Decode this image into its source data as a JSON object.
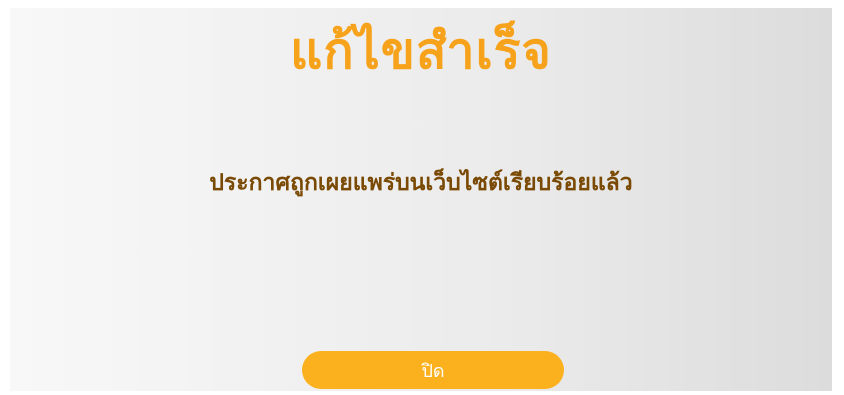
{
  "dialog": {
    "title": "แก้ไขสำเร็จ",
    "message": "ประกาศถูกเผยแพร่บนเว็บไซต์เรียบร้อยแล้ว",
    "close_label": "ปิด"
  },
  "colors": {
    "title": "#f7a21b",
    "message": "#7a4a05",
    "button": "#fbb11e",
    "button_text": "#ffffff"
  }
}
